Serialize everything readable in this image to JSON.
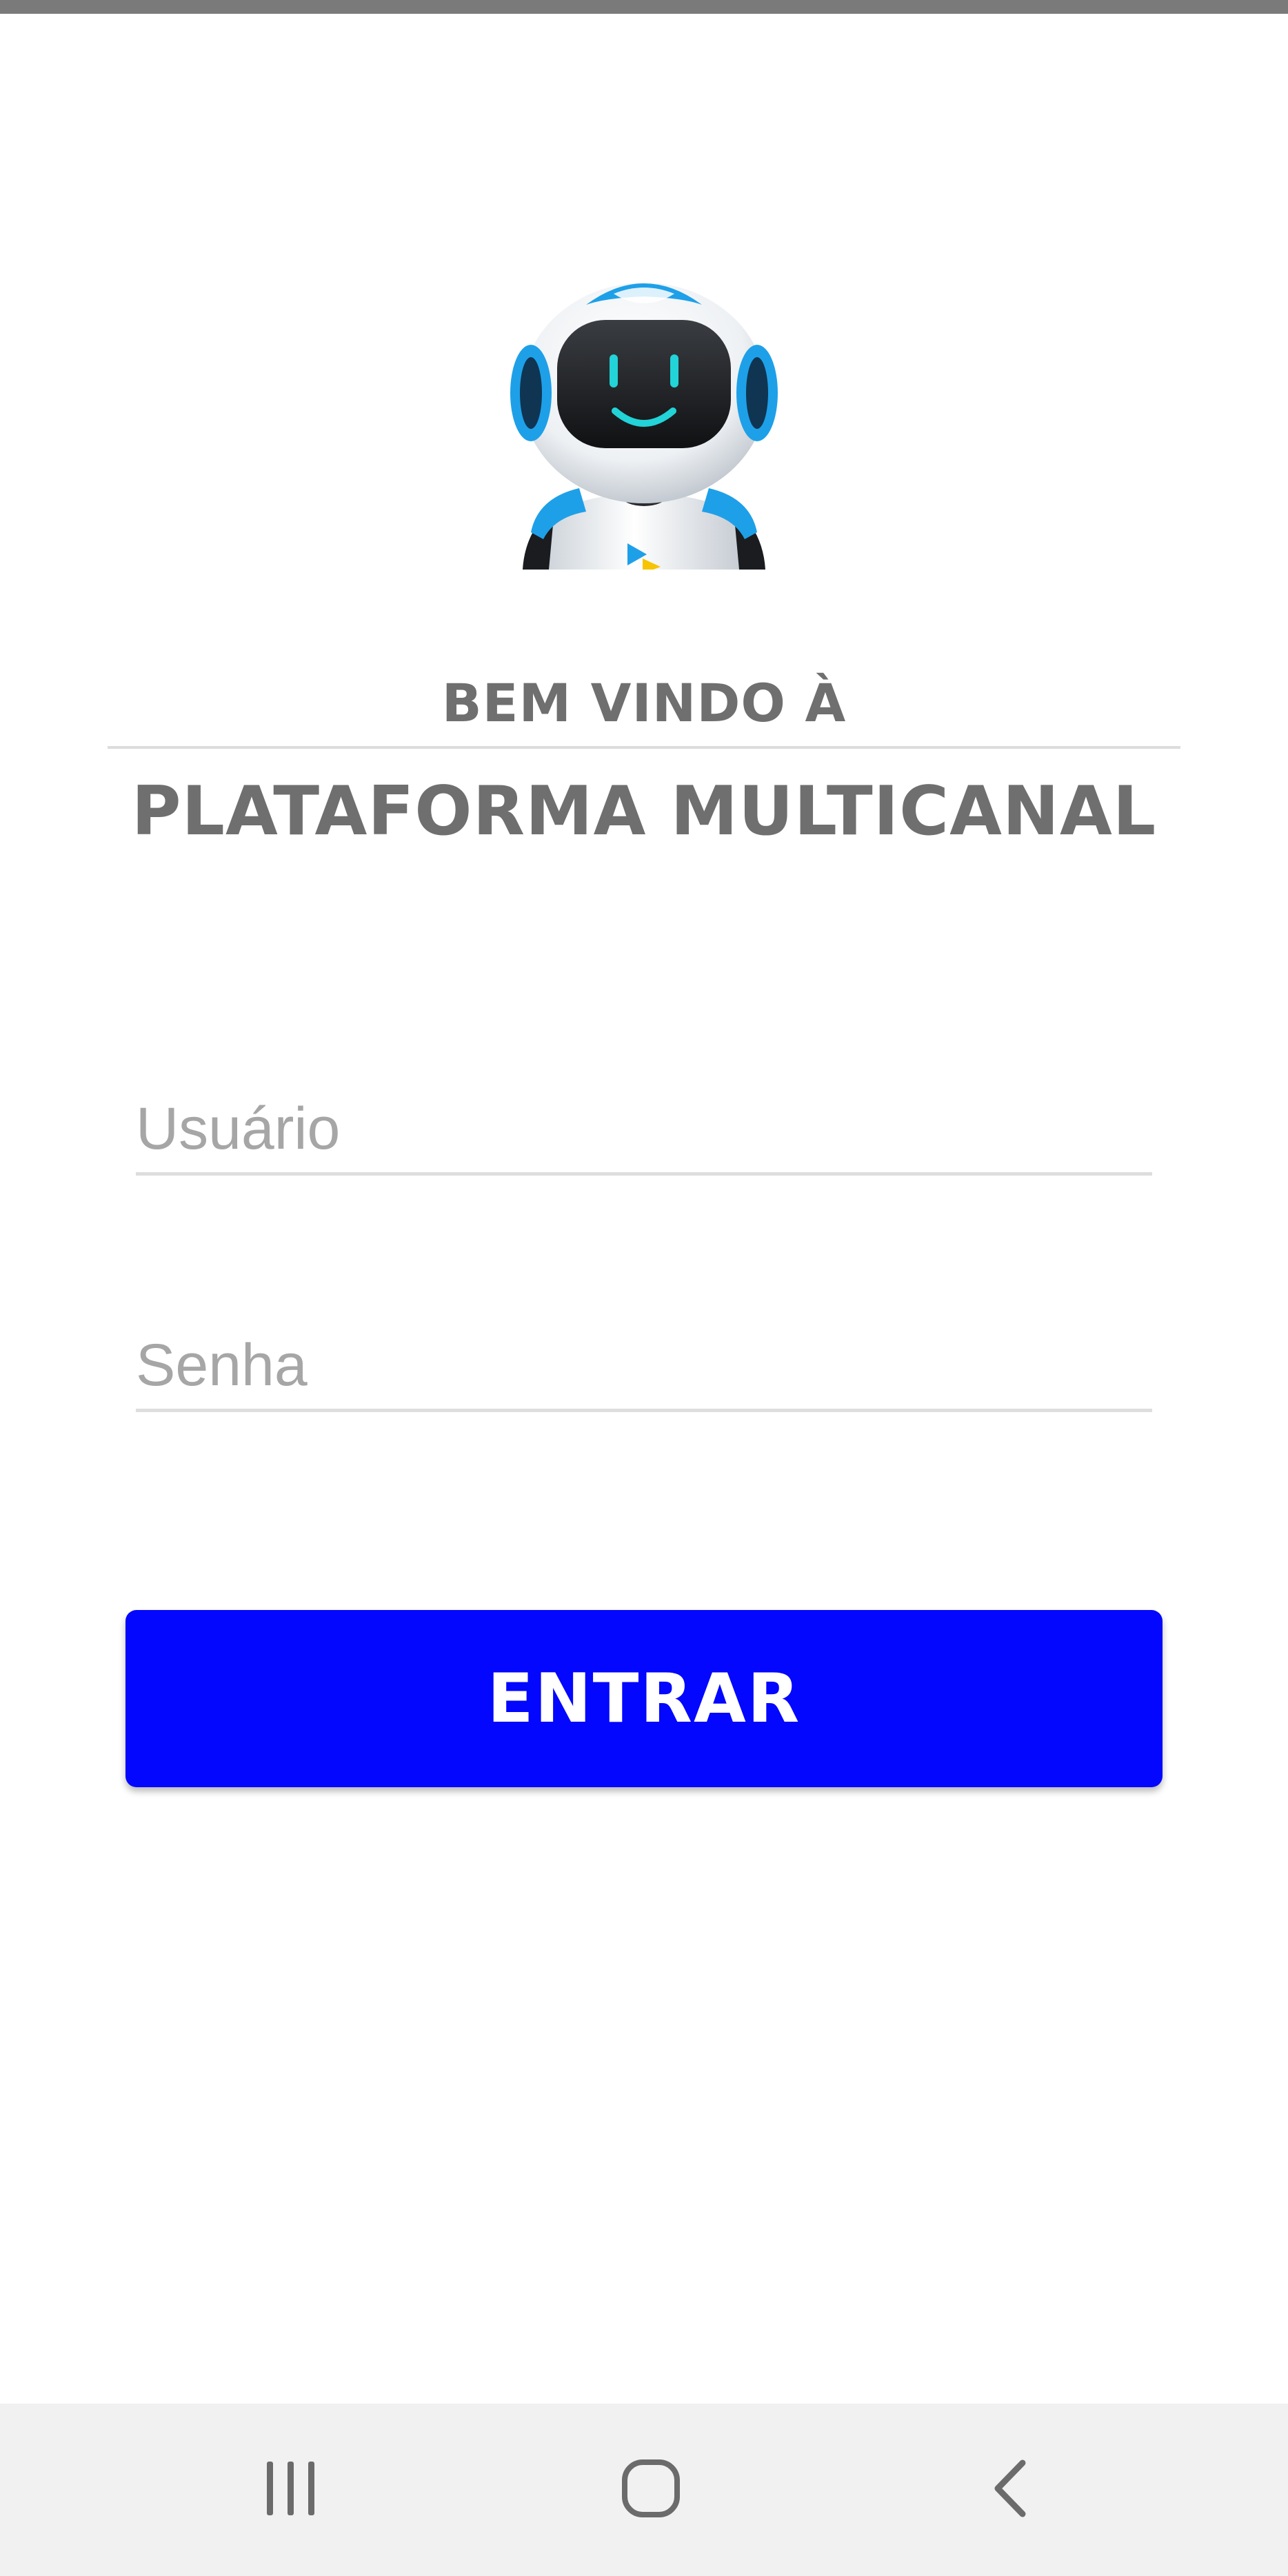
{
  "welcome": {
    "line1": "BEM VINDO À",
    "line2": "PLATAFORMA MULTICANAL"
  },
  "form": {
    "username": {
      "value": "",
      "placeholder": "Usuário"
    },
    "password": {
      "value": "",
      "placeholder": "Senha"
    },
    "submit_label": "ENTRAR"
  },
  "navigation": {
    "recent_icon": "recent-apps-icon",
    "home_icon": "home-icon",
    "back_icon": "back-icon"
  },
  "colors": {
    "primary_button": "#0307fd",
    "heading_text": "#6f6f6f",
    "placeholder_text": "#a6a6a6",
    "mascot_accent": "#1ea0e8",
    "mascot_face": "#22d3d8"
  }
}
